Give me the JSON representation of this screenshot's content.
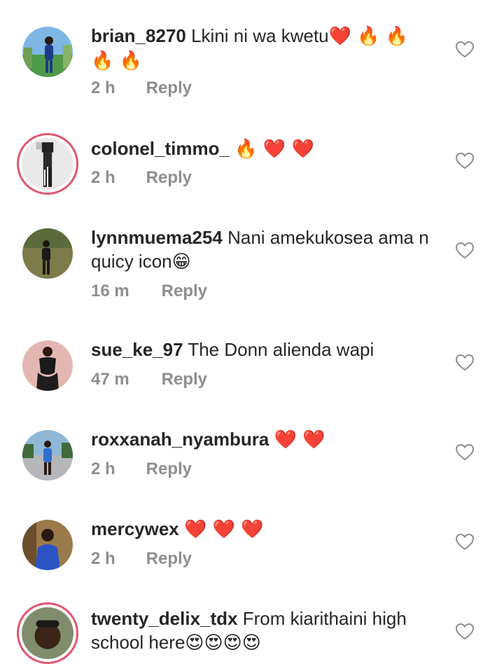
{
  "comments": [
    {
      "username": "brian_8270",
      "text": " Lkini ni wa kwetu",
      "emoji": "❤️ 🔥 🔥\n🔥 🔥",
      "time": "2 h",
      "reply": "Reply",
      "avatar_ring": false,
      "avatar_bg": "#5fa0d6"
    },
    {
      "username": "colonel_timmo_",
      "text": " ",
      "emoji": "🔥 ❤️ ❤️",
      "time": "2 h",
      "reply": "Reply",
      "avatar_ring": true,
      "avatar_bg": "#e9e6e6"
    },
    {
      "username": "lynnmuema254",
      "text": " Nani amekukosea ama n quicy icon",
      "emoji": "😁",
      "time": "16 m",
      "reply": "Reply",
      "avatar_ring": false,
      "avatar_bg": "#6b6a3a"
    },
    {
      "username": "sue_ke_97",
      "text": " The Donn alienda wapi",
      "emoji": "",
      "time": "47 m",
      "reply": "Reply",
      "avatar_ring": false,
      "avatar_bg": "#d9a7a2"
    },
    {
      "username": "roxxanah_nyambura",
      "text": " ",
      "emoji": "❤️ ❤️",
      "time": "2 h",
      "reply": "Reply",
      "avatar_ring": false,
      "avatar_bg": "#7aa5c8"
    },
    {
      "username": "mercywex",
      "text": " ",
      "emoji": "❤️ ❤️ ❤️",
      "time": "2 h",
      "reply": "Reply",
      "avatar_ring": false,
      "avatar_bg": "#8a6b3d"
    },
    {
      "username": "twenty_delix_tdx",
      "text": " From kiarithaini high school here",
      "emoji": "😍😍😍😍",
      "time": "",
      "reply": "",
      "avatar_ring": true,
      "avatar_bg": "#7a8b6a"
    }
  ],
  "colors": {
    "text": "#262626",
    "meta": "#8e8e8e",
    "heart_emoji": "#e0457b",
    "story_ring": "#e2556f"
  },
  "icons": {
    "like": "heart-outline-icon"
  }
}
